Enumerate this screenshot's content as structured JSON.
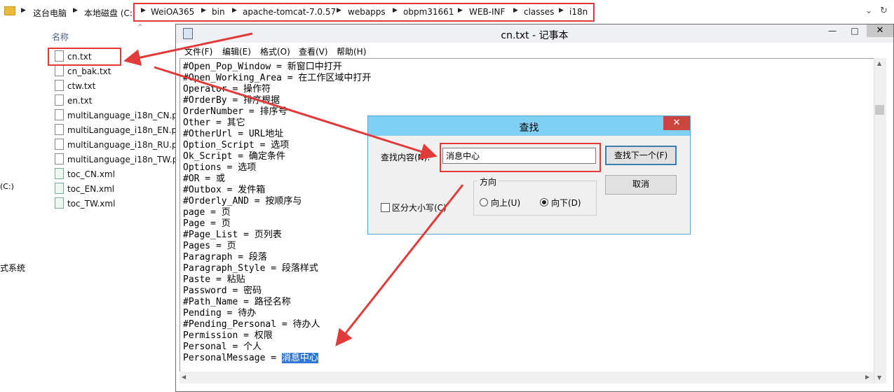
{
  "explorer": {
    "crumbs": [
      "这台电脑",
      "本地磁盘 (C:"
    ],
    "path": [
      "WeiOA365",
      "bin",
      "apache-tomcat-7.0.57",
      "webapps",
      "obpm31661",
      "WEB-INF",
      "classes",
      "i18n"
    ],
    "column_header": "名称",
    "files": [
      "cn.txt",
      "cn_bak.txt",
      "ctw.txt",
      "en.txt",
      "multiLanguage_i18n_CN.pro",
      "multiLanguage_i18n_EN.pro",
      "multiLanguage_i18n_RU.pro",
      "multiLanguage_i18n_TW.pro",
      "toc_CN.xml",
      "toc_EN.xml",
      "toc_TW.xml"
    ],
    "nav_drive": "(C:)",
    "nav_system": "式系统"
  },
  "notepad": {
    "title": "cn.txt - 记事本",
    "menu": [
      "文件(F)",
      "编辑(E)",
      "格式(O)",
      "查看(V)",
      "帮助(H)"
    ],
    "lines": [
      "#Open_Pop_Window = 新窗口中打开",
      "#Open_Working_Area = 在工作区域中打开",
      "Operator = 操作符",
      "#OrderBy = 排序根据",
      "OrderNumber = 排序号",
      "Other = 其它",
      "#OtherUrl = URL地址",
      "Option_Script = 选项",
      "Ok_Script = 确定条件",
      "Options = 选项",
      "#OR = 或",
      "#Outbox = 发件箱",
      "#Orderly_AND = 按顺序与",
      "page = 页",
      "Page = 页",
      "#Page_List = 页列表",
      "Pages = 页",
      "Paragraph = 段落",
      "Paragraph_Style = 段落样式",
      "Paste = 粘贴",
      "Password = 密码",
      "#Path_Name = 路径名称",
      "Pending = 待办",
      "#Pending_Personal = 待办人",
      "Permission = 权限",
      "Personal = 个人"
    ],
    "last_line_prefix": "PersonalMessage = ",
    "last_line_selected": "消息中心"
  },
  "find_dialog": {
    "title": "查找",
    "label": "查找内容(N):",
    "value": "消息中心",
    "find_next": "查找下一个(F)",
    "cancel": "取消",
    "direction": "方向",
    "up": "向上(U)",
    "down": "向下(D)",
    "match_case": "区分大小写(C)"
  },
  "colors": {
    "annotation_red": "#e03a3a",
    "selection_blue": "#3378d6",
    "find_title": "#7fd0f2"
  }
}
